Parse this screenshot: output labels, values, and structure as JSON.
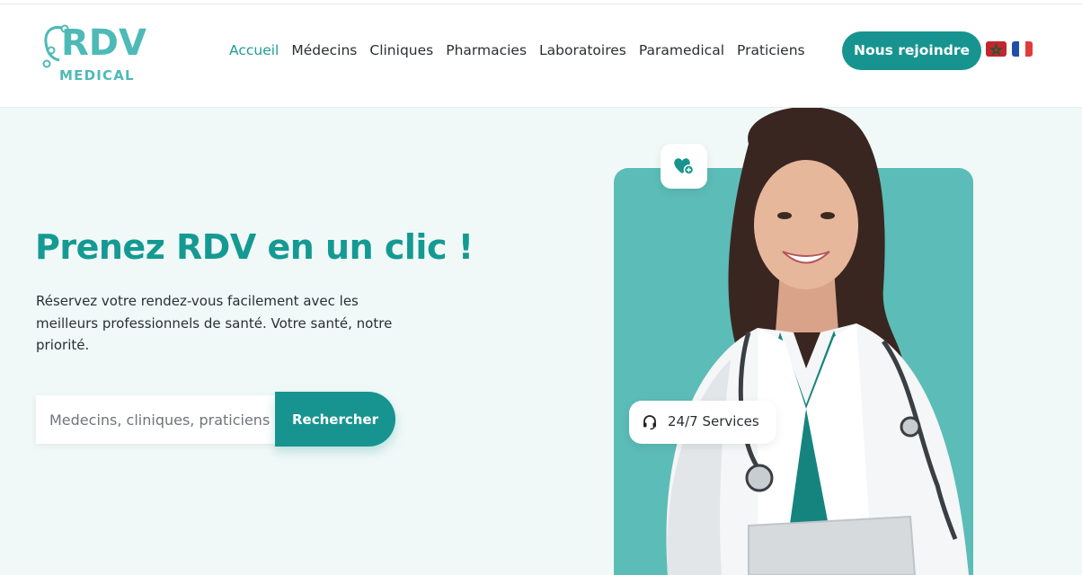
{
  "logo": {
    "main": "RDV",
    "sub": "MEDICAL"
  },
  "nav": {
    "items": [
      {
        "label": "Accueil",
        "active": true
      },
      {
        "label": "Médecins"
      },
      {
        "label": "Cliniques"
      },
      {
        "label": "Pharmacies"
      },
      {
        "label": "Laboratoires"
      },
      {
        "label": "Paramedical"
      },
      {
        "label": "Praticiens"
      }
    ],
    "join_label": "Nous rejoindre"
  },
  "flags": [
    {
      "name": "morocco-flag-icon"
    },
    {
      "name": "france-flag-icon"
    }
  ],
  "hero": {
    "title": "Prenez RDV en un clic !",
    "description": "Réservez votre rendez-vous facilement avec les meilleurs professionnels de santé. Votre santé, notre priorité."
  },
  "search": {
    "placeholder": "Medecins, cliniques, praticiens",
    "button_label": "Rechercher"
  },
  "badges": {
    "service": "24/7 Services",
    "service_icon": "headset-icon",
    "heart_icon": "heart-plus-icon"
  },
  "colors": {
    "accent": "#17948f",
    "accent_light": "#5cbcb7",
    "logo": "#4dbab7",
    "background": "#f1f9f8"
  }
}
